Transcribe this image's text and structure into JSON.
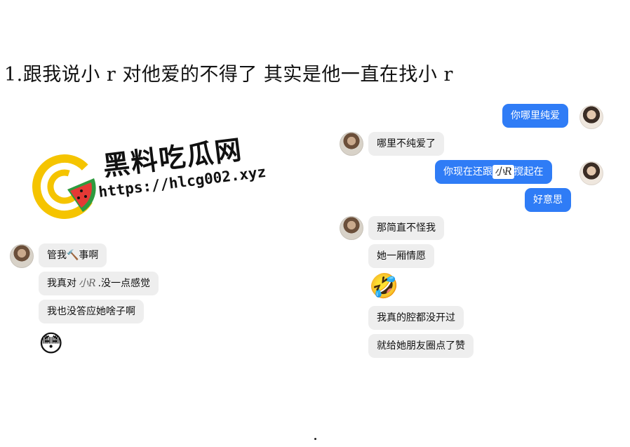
{
  "headline": "1.跟我说小 r 对他爱的不得了  其实是他一直在找小 r",
  "watermark": {
    "title": "黑料吃瓜网",
    "url": "https://hlcg002.xyz",
    "logo_colors": {
      "ring": "#f5c400",
      "melon_red": "#e53935",
      "melon_green": "#2e9b3f"
    }
  },
  "left_chat": {
    "messages": [
      {
        "text": "管我🔨事啊"
      },
      {
        "prefix": "我真对",
        "handwritten": "小R",
        "suffix": ".没一点感觉"
      },
      {
        "text": "我也没答应她啥子啊"
      },
      {
        "emoji": "😳"
      }
    ]
  },
  "right_chat": {
    "messages": [
      {
        "side": "out",
        "text": "你哪里纯爱"
      },
      {
        "side": "in",
        "text": "哪里不纯爱了"
      },
      {
        "side": "out",
        "prefix": "你现在还跟",
        "handwritten": "小R",
        "suffix": "搅起在"
      },
      {
        "side": "out",
        "text": "好意思"
      },
      {
        "side": "in",
        "text": "那简直不怪我"
      },
      {
        "side": "in",
        "text": "她一厢情愿"
      },
      {
        "side": "in",
        "emoji": "🤣"
      },
      {
        "side": "in",
        "text": "我真的腔都没开过"
      },
      {
        "side": "in",
        "text": "就给她朋友圈点了赞"
      }
    ]
  },
  "colors": {
    "out_bubble": "#2f7cf6",
    "in_bubble": "#eeeeee"
  }
}
